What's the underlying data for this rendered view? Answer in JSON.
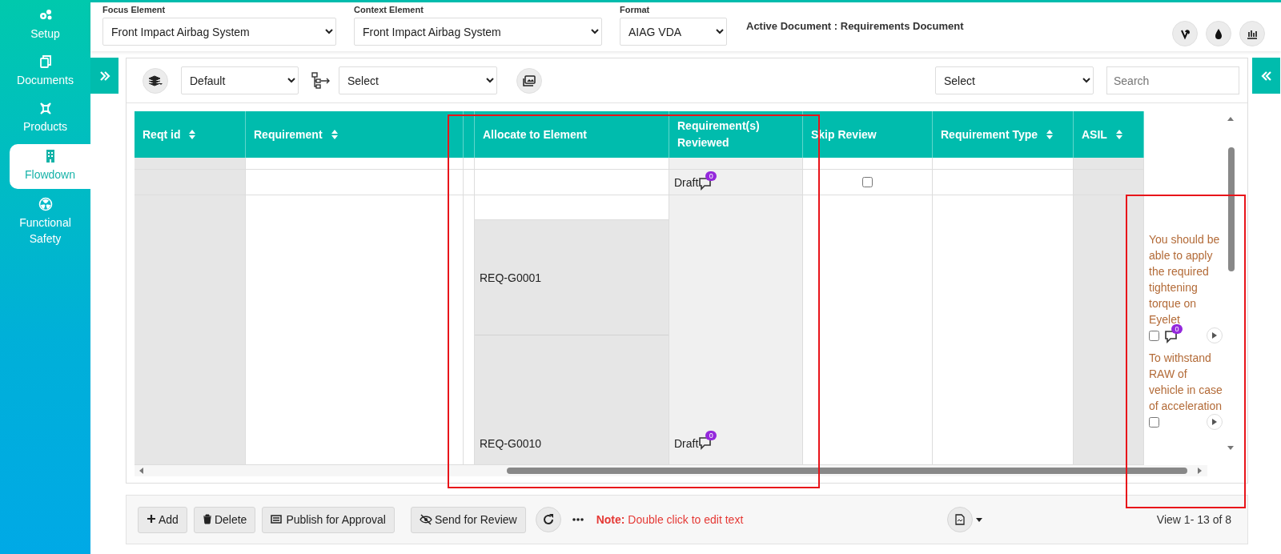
{
  "sidebar": {
    "items": [
      {
        "label": "Setup",
        "selected": false
      },
      {
        "label": "Documents",
        "selected": false
      },
      {
        "label": "Products",
        "selected": false
      },
      {
        "label": "Flowdown",
        "selected": true
      },
      {
        "label": "Functional Safety",
        "selected": false
      }
    ]
  },
  "top_bar": {
    "fields": [
      {
        "label": "Focus Element",
        "value": "Front Impact Airbag System"
      },
      {
        "label": "Context Element",
        "value": "Front Impact Airbag System"
      },
      {
        "label": "Format",
        "value": "AIAG VDA"
      }
    ],
    "active_document": "Active Document : Requirements Document"
  },
  "toolbar": {
    "view_select": "Default",
    "group_select": "Select",
    "filter_select": "Select",
    "search": {
      "placeholder": "Search"
    }
  },
  "table": {
    "columns": [
      {
        "label": "Reqt id",
        "sortable": true
      },
      {
        "label": "Requirement",
        "sortable": true
      },
      {
        "label": "Allocate to Element",
        "sortable": false
      },
      {
        "label": "Requirement(s) Reviewed",
        "sortable": false
      },
      {
        "label": "Skip Review",
        "sortable": false
      },
      {
        "label": "Requirement Type",
        "sortable": true
      },
      {
        "label": "ASIL",
        "sortable": true
      }
    ],
    "rows": [
      {
        "allocations": [],
        "reviewed": "Draft",
        "comments": "0",
        "skip_review": false
      },
      {
        "allocations": [
          "REQ-G0001",
          "REQ-G0010"
        ],
        "reviewed": "Draft",
        "comments": "0"
      }
    ],
    "overflow_items": [
      {
        "text": "You should be able to apply the required tightening torque on Eyelet",
        "checked": false,
        "comments": "0"
      },
      {
        "text": "To withstand RAW of vehicle in case of acceleration",
        "checked": false
      }
    ]
  },
  "bottom_bar": {
    "buttons": [
      "Add",
      "Delete",
      "Publish for Approval",
      "Send for Review"
    ],
    "note_label": "Note:",
    "note": "Double click to edit text",
    "pager": "View 1- 13 of 8"
  }
}
